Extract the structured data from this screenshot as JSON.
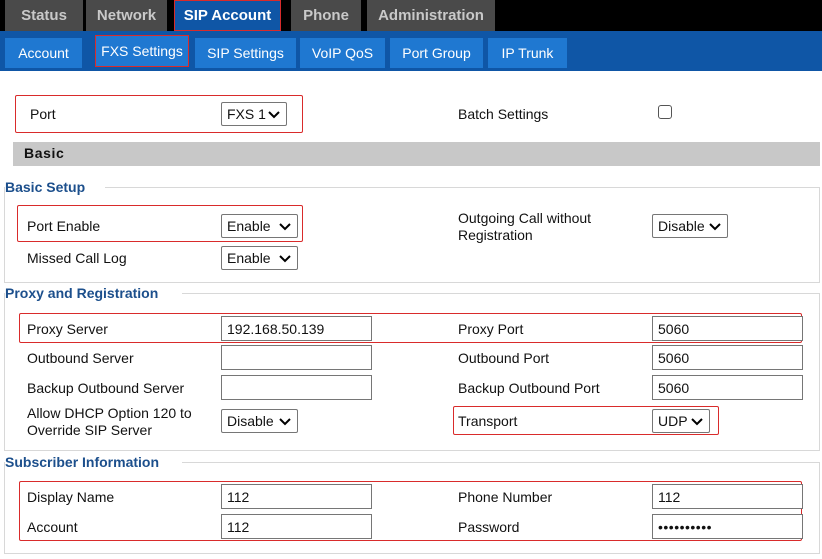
{
  "top_tabs": [
    "Status",
    "Network",
    "SIP Account",
    "Phone",
    "Administration"
  ],
  "sub_tabs": [
    "Account",
    "FXS Settings",
    "SIP Settings",
    "VoIP QoS",
    "Port Group",
    "IP Trunk"
  ],
  "port": {
    "label": "Port",
    "value": "FXS 1"
  },
  "batch_settings": {
    "label": "Batch Settings",
    "checked": false
  },
  "basic_header": "Basic",
  "basic_setup": {
    "title": "Basic Setup",
    "port_enable_label": "Port Enable",
    "port_enable_value": "Enable",
    "outgoing_label": "Outgoing Call without Registration",
    "outgoing_value": "Disable",
    "missed_call_label": "Missed Call Log",
    "missed_call_value": "Enable"
  },
  "proxy": {
    "title": "Proxy and Registration",
    "proxy_server_label": "Proxy Server",
    "proxy_server_value": "192.168.50.139",
    "proxy_port_label": "Proxy Port",
    "proxy_port_value": "5060",
    "outbound_server_label": "Outbound Server",
    "outbound_server_value": "",
    "outbound_port_label": "Outbound Port",
    "outbound_port_value": "5060",
    "backup_server_label": "Backup Outbound Server",
    "backup_server_value": "",
    "backup_port_label": "Backup Outbound Port",
    "backup_port_value": "5060",
    "dhcp_label": "Allow DHCP Option 120 to Override SIP Server",
    "dhcp_value": "Disable",
    "transport_label": "Transport",
    "transport_value": "UDP"
  },
  "subscriber": {
    "title": "Subscriber Information",
    "display_name_label": "Display Name",
    "display_name_value": "112",
    "phone_number_label": "Phone Number",
    "phone_number_value": "112",
    "account_label": "Account",
    "account_value": "112",
    "password_label": "Password",
    "password_value": "••••••••••"
  },
  "colors": {
    "top_bar": "#000000",
    "top_tab": "#4a4a4a",
    "active_tab": "#0f56a6",
    "sub_tab": "#1f78d1",
    "highlight": "#d92b2b",
    "section_title": "#1c4f8c"
  }
}
